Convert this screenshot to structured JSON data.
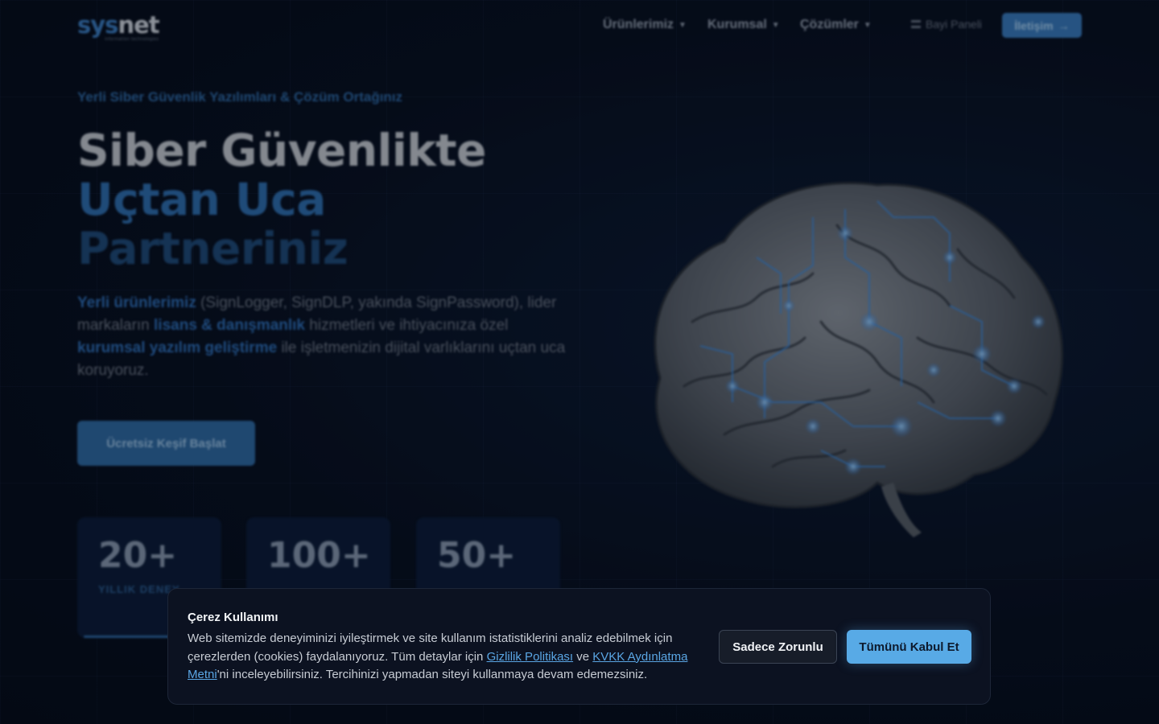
{
  "header": {
    "logo_sys": "sys",
    "logo_net": "net",
    "logo_tagline": "information technologies",
    "nav": [
      {
        "label": "Ürünlerimiz",
        "icon": "chevron-down-icon"
      },
      {
        "label": "Kurumsal",
        "icon": "chevron-down-icon"
      },
      {
        "label": "Çözümler",
        "icon": "chevron-down-icon"
      }
    ],
    "dealer_panel": "Bayi Paneli",
    "contact_button": "İletişim",
    "contact_arrow": "→"
  },
  "hero": {
    "eyebrow": "Yerli Siber Güvenlik Yazılımları & Çözüm Ortağınız",
    "title_line1": "Siber Güvenlikte",
    "title_line2": "Uçtan Uca",
    "title_line3": "Partneriniz",
    "lead_parts": [
      {
        "text": "Yerli ürünlerimiz",
        "highlight": true
      },
      {
        "text": " (SignLogger, SignDLP, yakında SignPassword), lider markaların ",
        "highlight": false
      },
      {
        "text": "lisans & danışmanlık",
        "highlight": true
      },
      {
        "text": " hizmetleri ve ihtiyacınıza özel ",
        "highlight": false
      },
      {
        "text": "kurumsal yazılım geliştirme",
        "highlight": true
      },
      {
        "text": " ile işletmenizin dijital varlıklarını uçtan uca koruyoruz.",
        "highlight": false
      }
    ],
    "cta_label": "Ücretsiz Keşif Başlat",
    "stats": [
      {
        "value": "20+",
        "label": "YILLIK DENEY"
      },
      {
        "value": "100+",
        "label": ""
      },
      {
        "value": "50+",
        "label": ""
      }
    ]
  },
  "cookie": {
    "title": "Çerez Kullanımı",
    "text_before": "Web sitemizde deneyiminizi iyileştirmek ve site kullanım istatistiklerini analiz edebilmek için çerezlerden (cookies) faydalanıyoruz. Tüm detaylar için ",
    "privacy_link": "Gizlilik Politikası",
    "text_middle": " ve ",
    "kvkk_link": "KVKK Aydınlatma Metni",
    "text_after": "'ni inceleyebilirsiniz. Tercihinizi yapmadan siteyi kullanmaya devam edemezsiniz.",
    "reject_button": "Sadece Zorunlu",
    "accept_button": "Tümünü Kabul Et"
  },
  "colors": {
    "accent": "#58aae6",
    "brand_blue": "#3a7cbf",
    "background": "#070e1d"
  }
}
